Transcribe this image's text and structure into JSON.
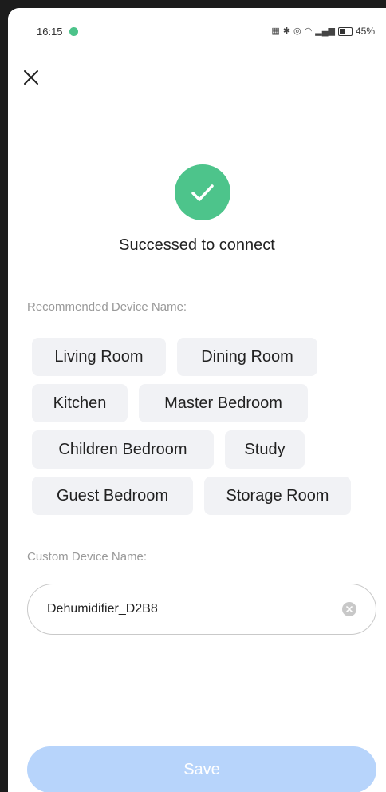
{
  "status_bar": {
    "time": "16:15",
    "battery": "45%",
    "icons": [
      "vibrate-icon",
      "bluetooth-icon",
      "hotspot-icon",
      "wifi-icon",
      "signal-icon",
      "battery-icon"
    ]
  },
  "close_icon": "close-icon",
  "success": {
    "icon": "checkmark-icon",
    "color": "#4dc48b",
    "title": "Successed to connect"
  },
  "recommended": {
    "label": "Recommended Device Name:",
    "chips": [
      "Living Room",
      "Dining Room",
      "Kitchen",
      "Master Bedroom",
      "Children Bedroom",
      "Study",
      "Guest Bedroom",
      "Storage Room"
    ]
  },
  "custom": {
    "label": "Custom Device Name:",
    "value": "Dehumidifier_D2B8"
  },
  "save": {
    "label": "Save",
    "color": "#b7d4fb"
  }
}
